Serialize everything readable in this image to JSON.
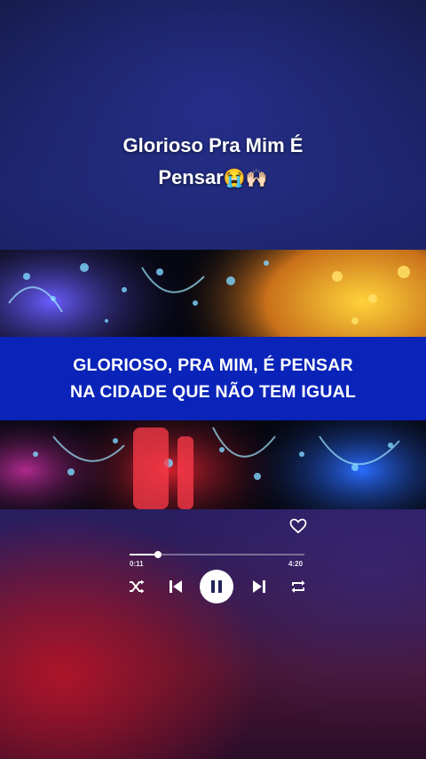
{
  "caption": {
    "line1": "Glorioso Pra Mim É",
    "line2": "Pensar",
    "emojis": "😭🙌🏻"
  },
  "lyrics": {
    "line1": "GLORIOSO, PRA MIM, É PENSAR",
    "line2": "NA CIDADE QUE NÃO TEM IGUAL"
  },
  "player": {
    "elapsed": "0:11",
    "duration": "4:20",
    "progress_fraction": 0.16,
    "icons": [
      "heart-icon",
      "shuffle-icon",
      "previous-icon",
      "pause-icon",
      "next-icon",
      "repeat-icon"
    ],
    "accent": "#ffffff"
  },
  "colors": {
    "lyric_band": "#0a23b8",
    "background_top": "#1c2468",
    "background_bottom_glow": "#be1428"
  }
}
